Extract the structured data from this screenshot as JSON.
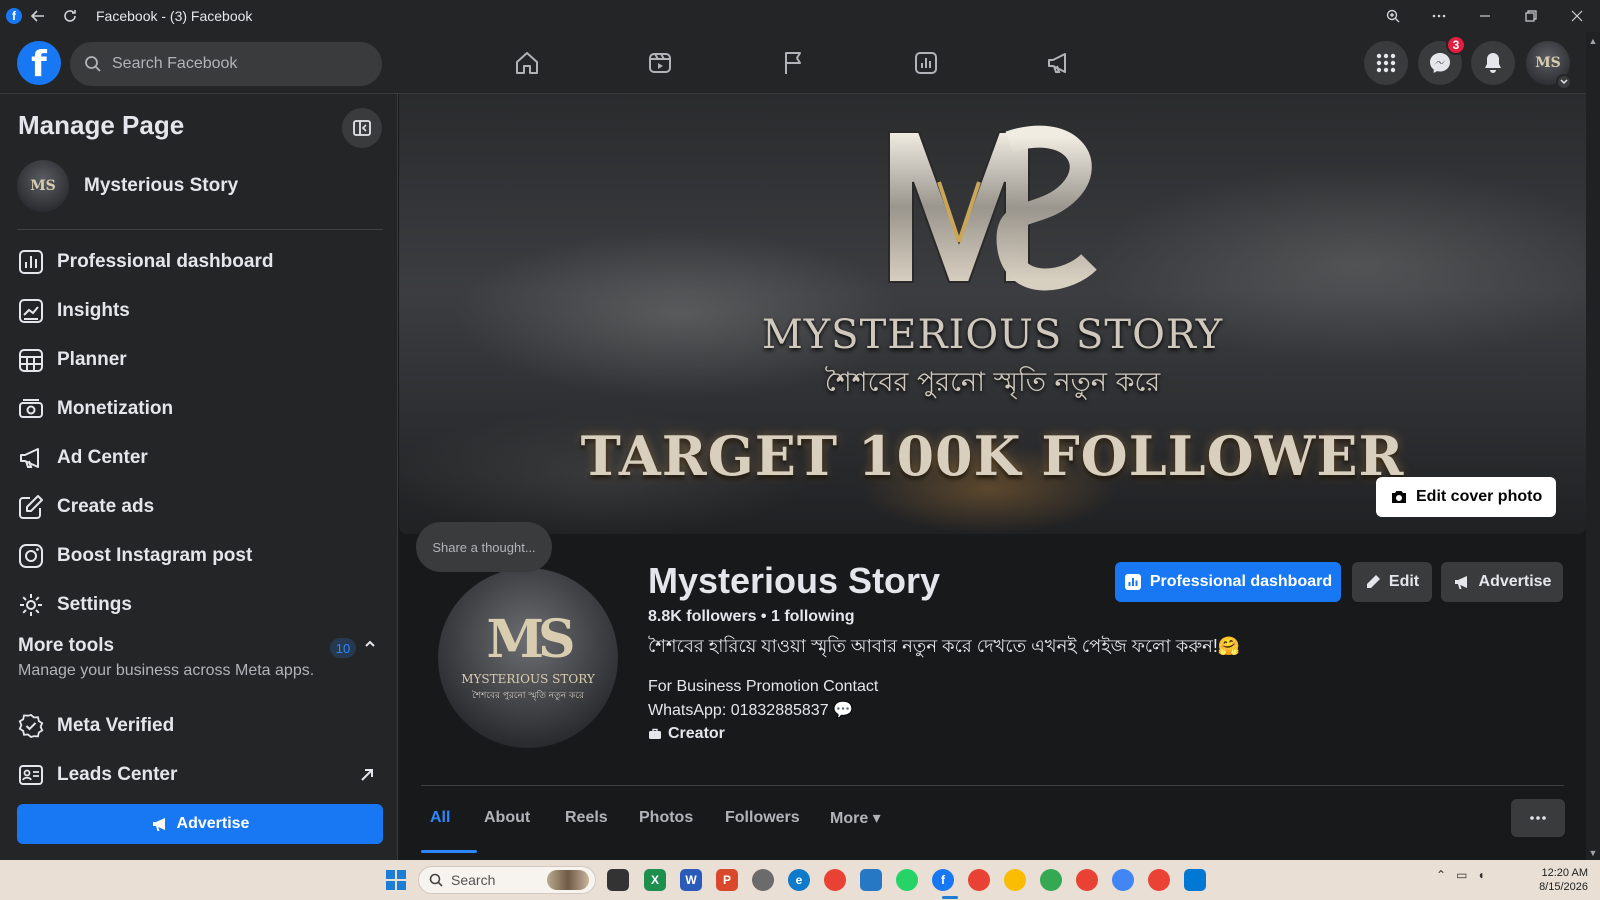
{
  "window": {
    "title": "Facebook - (3) Facebook"
  },
  "topbar": {
    "search_placeholder": "Search Facebook",
    "messenger_badge": "3"
  },
  "sidebar": {
    "title": "Manage Page",
    "page_name": "Mysterious Story",
    "items": [
      {
        "label": "Professional dashboard",
        "icon": "dashboard-icon"
      },
      {
        "label": "Insights",
        "icon": "insights-icon"
      },
      {
        "label": "Planner",
        "icon": "calendar-icon"
      },
      {
        "label": "Monetization",
        "icon": "monetization-icon"
      },
      {
        "label": "Ad Center",
        "icon": "megaphone-icon"
      },
      {
        "label": "Create ads",
        "icon": "pencil-square-icon"
      },
      {
        "label": "Boost Instagram post",
        "icon": "instagram-icon"
      },
      {
        "label": "Settings",
        "icon": "gear-icon"
      }
    ],
    "more_tools": {
      "title": "More tools",
      "subtitle": "Manage your business across Meta apps.",
      "count": "10"
    },
    "tools": [
      {
        "label": "Meta Verified",
        "icon": "verified-badge-icon"
      },
      {
        "label": "Leads Center",
        "icon": "leads-icon"
      }
    ],
    "advertise_label": "Advertise"
  },
  "cover": {
    "title": "MYSTERIOUS STORY",
    "subtitle": "শৈশবের পুরনো স্মৃতি নতুন করে",
    "banner": "TARGET 100K FOLLOWER",
    "edit_label": "Edit cover photo"
  },
  "profile": {
    "thought_placeholder": "Share a thought...",
    "logo_text": "MYSTERIOUS STORY",
    "logo_subtext": "শৈশবের পুরনো স্মৃতি নতুন করে",
    "name": "Mysterious Story",
    "followers_line": "8.8K followers • 1 following",
    "bio": "শৈশবের হারিয়ে যাওয়া স্মৃতি আবার নতুন করে দেখতে এখনই পেইজ ফলো করুন!🤗",
    "contact_line1": "For Business Promotion Contact",
    "contact_line2": "WhatsApp: 01832885837 💬",
    "category": "Creator",
    "buttons": {
      "professional_dashboard": "Professional dashboard",
      "edit": "Edit",
      "advertise": "Advertise"
    }
  },
  "tabs": [
    {
      "label": "All",
      "active": true
    },
    {
      "label": "About",
      "active": false
    },
    {
      "label": "Reels",
      "active": false
    },
    {
      "label": "Photos",
      "active": false
    },
    {
      "label": "Followers",
      "active": false
    },
    {
      "label": "More ▾",
      "active": false
    }
  ],
  "taskbar": {
    "search_placeholder": "Search",
    "time": "12:20 AM",
    "date": "8/15/2026"
  },
  "colors": {
    "accent": "#1877f2",
    "background": "#18191a",
    "surface": "#242526"
  }
}
